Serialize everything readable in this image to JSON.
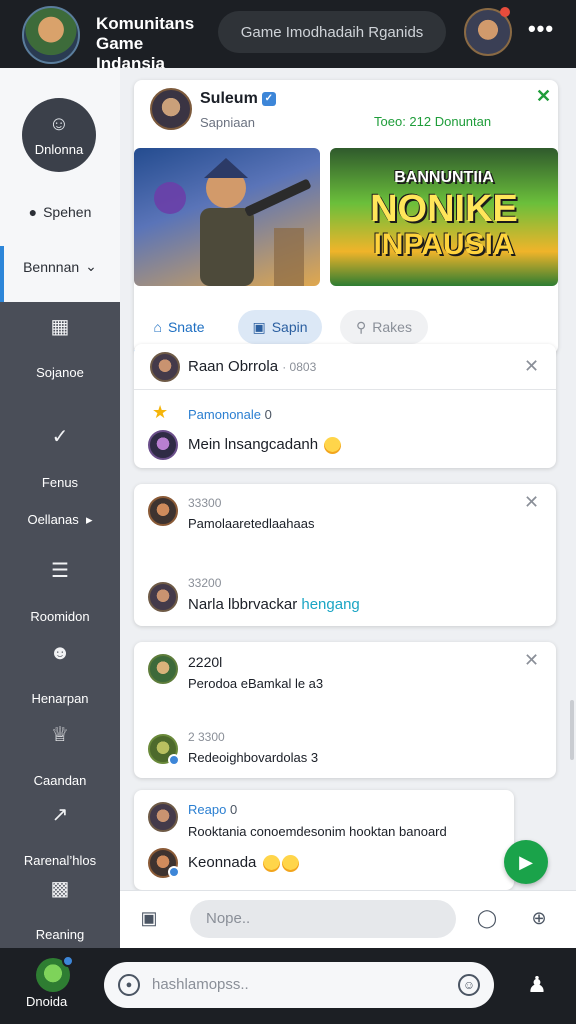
{
  "topbar": {
    "title_line1": "Komunitans",
    "title_line2": "Game Indansia",
    "search": "Game Imodhadaih Rganids",
    "more": "•••"
  },
  "sidebar": {
    "circle_label": "Dnlonna",
    "link1": "Spehen",
    "link2": "Bennnan",
    "items": [
      {
        "label": "Sojanoe",
        "icon": "photos-icon"
      },
      {
        "label": "Fenus",
        "icon": "pin-icon"
      },
      {
        "label": "Oellanas",
        "icon": "play-icon"
      },
      {
        "label": "Roomidon",
        "icon": "list-icon"
      },
      {
        "label": "Henarpan",
        "icon": "smile-icon"
      },
      {
        "label": "Caandan",
        "icon": "trophy-icon"
      },
      {
        "label": "Rarenal’hlos",
        "icon": "chart-icon"
      },
      {
        "label": "Reaning",
        "icon": "book-icon"
      }
    ]
  },
  "profile": {
    "name": "Suleum",
    "sub": "Sapniaan",
    "stat": "Toeo:  212 Donuntan",
    "banner_b_l1": "BANNUNTIIA",
    "banner_b_l2": "NONIKE",
    "banner_b_l3": "INPAUSIA",
    "tabs": [
      "Snate",
      "Sapin",
      "Rakes"
    ]
  },
  "chats": {
    "c1_header": "Raan Obrrola",
    "c1_header_time": "· 0803",
    "c1_name": "Pamononale",
    "c1_name_num": "0",
    "c1_msg": "Mein lnsangcadanh",
    "c2_time1": "33300",
    "c2_msg1": "Pamolaaretedlaahaas",
    "c2_time2": "33200",
    "c2_msg2a": "Narla lbbrvackar ",
    "c2_msg2b": "hengang",
    "c3_time1": "2220l",
    "c3_msg1": "Perodoa eBamkal le a3",
    "c3_time2": "2 3300",
    "c3_msg2": "Redeoighbovardolas 3",
    "c4_name": "Reapo",
    "c4_name_num": "0",
    "c4_msg1": "Rooktania conoemdesonim hooktan banoard",
    "c4_msg2": "Keonnada"
  },
  "composer": {
    "placeholder": "Nope.."
  },
  "bottombar": {
    "label": "Dnoida",
    "placeholder": "hashlamopss.."
  },
  "colors": {
    "accent_blue": "#2d86d9",
    "accent_green": "#1aa34a",
    "sidebar_bg": "#4a4e58",
    "bar_bg": "#1c1f24"
  }
}
